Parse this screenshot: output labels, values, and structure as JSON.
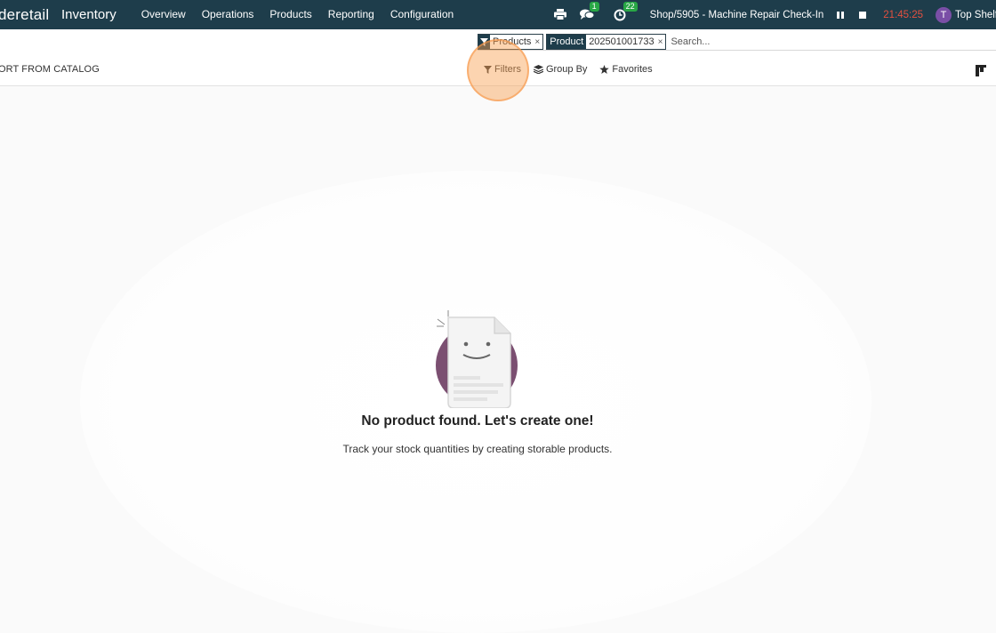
{
  "navbar": {
    "brand": "deretail",
    "app_name": "Inventory",
    "menu": [
      "Overview",
      "Operations",
      "Products",
      "Reporting",
      "Configuration"
    ],
    "icons": {
      "print": "printer-icon",
      "chat": "chat-icon",
      "activity": "clock-icon"
    },
    "chat_count": "1",
    "activity_count": "22",
    "shop": "Shop/5905 - Machine Repair Check-In",
    "time": "21:45:25",
    "avatar_initial": "T",
    "user": "Top Shelf",
    "colors": {
      "bar": "#1e3d4b",
      "time": "#e4503f",
      "badge": "#28a745",
      "avatar": "#7a4fa6"
    }
  },
  "search": {
    "facets": [
      {
        "key": "",
        "value": "Products"
      },
      {
        "key": "Product",
        "value": "202501001733"
      }
    ],
    "placeholder": "Search..."
  },
  "control": {
    "catalog_button": "ORT FROM CATALOG",
    "filters": "Filters",
    "group_by": "Group By",
    "favorites": "Favorites"
  },
  "empty_state": {
    "title": "No product found. Let's create one!",
    "text": "Track your stock quantities by creating storable products."
  }
}
